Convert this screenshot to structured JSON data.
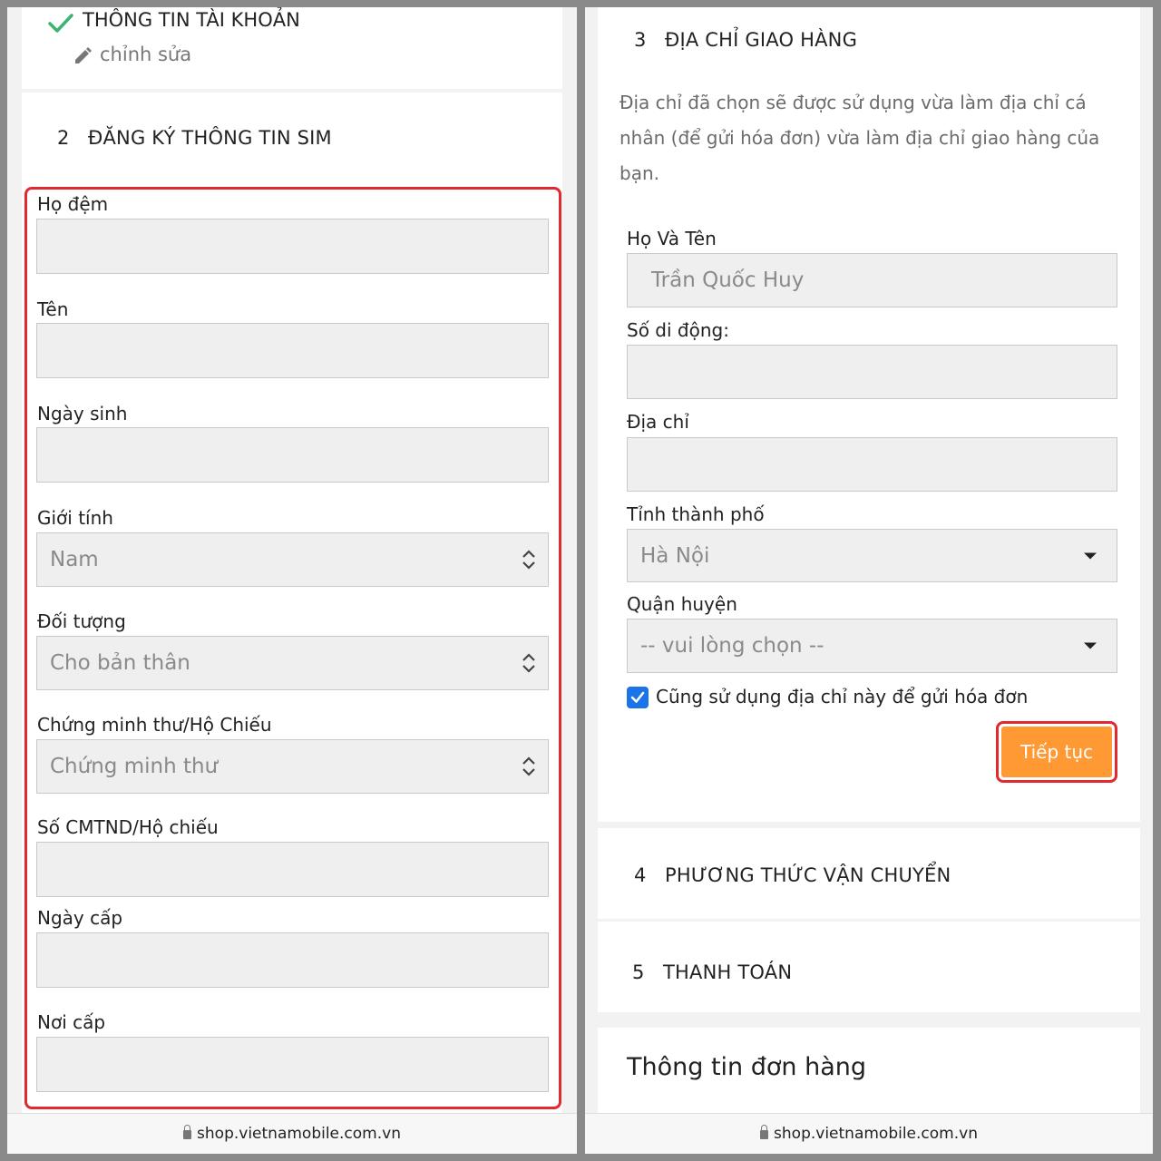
{
  "left": {
    "account_section": {
      "title": "THÔNG TIN TÀI KHOẢN",
      "edit_label": "chỉnh sửa"
    },
    "sim_section": {
      "number": "2",
      "title": "ĐĂNG KÝ THÔNG TIN SIM",
      "fields": {
        "ho_dem": {
          "label": "Họ đệm",
          "value": ""
        },
        "ten": {
          "label": "Tên",
          "value": ""
        },
        "ngay_sinh": {
          "label": "Ngày sinh",
          "value": ""
        },
        "gioi_tinh": {
          "label": "Giới tính",
          "value": "Nam"
        },
        "doi_tuong": {
          "label": "Đối tượng",
          "value": "Cho bản thân"
        },
        "giay_to": {
          "label": "Chứng minh thư/Hộ Chiếu",
          "value": "Chứng minh thư"
        },
        "so_cmtnd": {
          "label": "Số CMTND/Hộ chiếu",
          "value": ""
        },
        "ngay_cap": {
          "label": "Ngày cấp",
          "value": ""
        },
        "noi_cap": {
          "label": "Nơi cấp",
          "value": ""
        }
      }
    },
    "url": "shop.vietnamobile.com.vn"
  },
  "right": {
    "address_section": {
      "number": "3",
      "title": "ĐỊA CHỈ GIAO HÀNG",
      "description_lines": [
        "Địa chỉ đã chọn sẽ được sử dụng vừa làm địa chỉ cá",
        "nhân (để gửi hóa đơn) vừa làm địa chỉ giao hàng của",
        "bạn."
      ],
      "fields": {
        "ho_ten": {
          "label": "Họ Và Tên",
          "value": "Trần Quốc Huy"
        },
        "so_di_dong": {
          "label": "Số di động:",
          "value": ""
        },
        "dia_chi": {
          "label": "Địa chỉ",
          "value": ""
        },
        "tinh_thanh": {
          "label": "Tỉnh thành phố",
          "value": "Hà Nội"
        },
        "quan_huyen": {
          "label": "Quận huyện",
          "value": "-- vui lòng chọn --"
        }
      },
      "checkbox_label": "Cũng sử dụng địa chỉ này để gửi hóa đơn",
      "checkbox_checked": true,
      "continue_button": "Tiếp tục"
    },
    "shipping_section": {
      "number": "4",
      "title": "PHƯƠNG THỨC VẬN CHUYỂN"
    },
    "payment_section": {
      "number": "5",
      "title": "THANH TOÁN"
    },
    "order_info_title": "Thông tin đơn hàng",
    "url": "shop.vietnamobile.com.vn"
  },
  "colors": {
    "accent_orange": "#ff9933",
    "highlight_red": "#e02a2f",
    "check_green": "#3cb371",
    "checkbox_blue": "#1a73e8"
  },
  "icons": [
    "check-icon",
    "pencil-icon",
    "updown-icon",
    "caret-down-icon",
    "lock-icon"
  ]
}
